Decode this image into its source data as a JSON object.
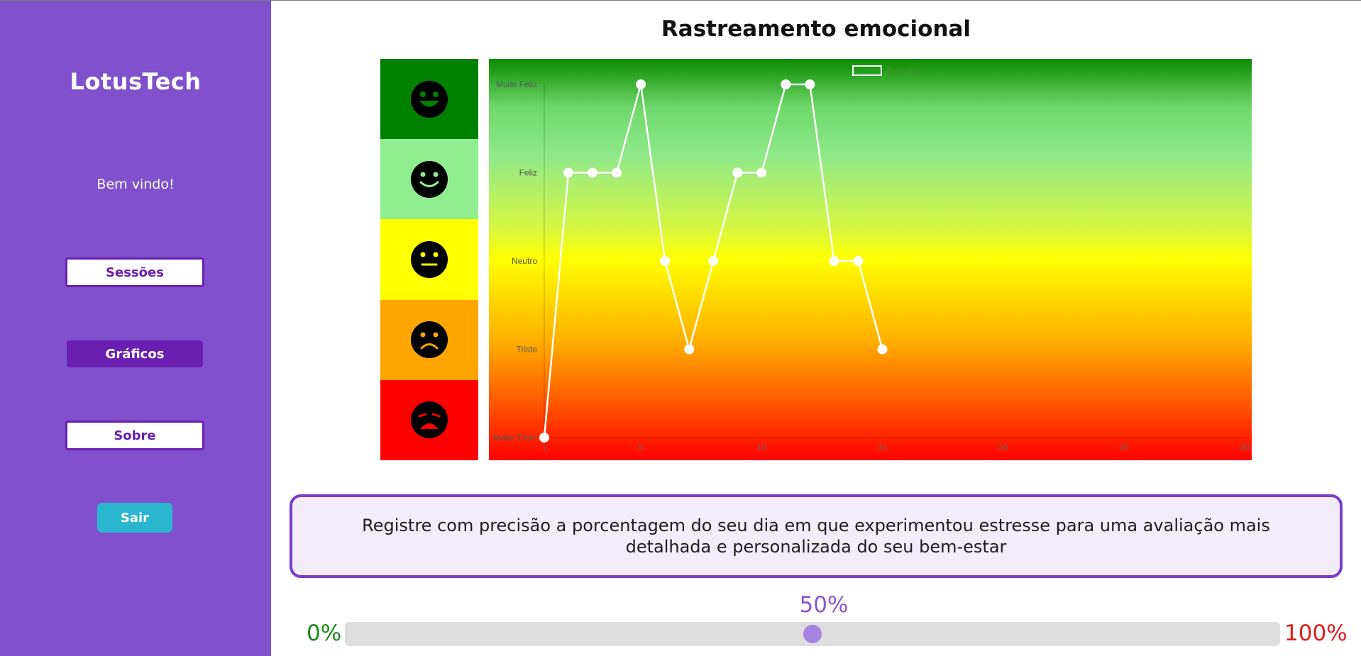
{
  "sidebar": {
    "brand": "LotusTech",
    "welcome": "Bem vindo!",
    "nav": [
      {
        "label": "Sessões"
      },
      {
        "label": "Gráficos"
      },
      {
        "label": "Sobre"
      }
    ],
    "logout": "Sair",
    "color": "#8150cc",
    "active_color": "#6a1fb0"
  },
  "main": {
    "title": "Rastreamento emocional",
    "info_text": "Registre com precisão a porcentagem do seu dia em que experimentou estresse para uma avaliação mais detalhada e personalizada do seu bem-estar"
  },
  "emoji_scale": [
    {
      "icon": "very-happy-face-icon",
      "color": "#008000"
    },
    {
      "icon": "happy-face-icon",
      "color": "#90ee90"
    },
    {
      "icon": "neutral-face-icon",
      "color": "#ffff00"
    },
    {
      "icon": "sad-face-icon",
      "color": "#ffa500"
    },
    {
      "icon": "very-sad-face-icon",
      "color": "#ff0000"
    }
  ],
  "chart_data": {
    "type": "line",
    "title": "",
    "legend": "Emoção",
    "legend_position": "top-center",
    "x_ticks": [
      1,
      5,
      10,
      15,
      20,
      25,
      30
    ],
    "xlim": [
      1,
      30
    ],
    "y_categories": [
      "Muito Triste",
      "Triste",
      "Neutro",
      "Feliz",
      "Muito Feliz"
    ],
    "series": [
      {
        "name": "Emoção",
        "color": "#ffffff",
        "x": [
          1,
          2,
          3,
          4,
          5,
          6,
          7,
          8,
          9,
          10,
          11,
          12,
          13,
          14,
          15
        ],
        "values": [
          0,
          3,
          3,
          3,
          4,
          2,
          1,
          2,
          3,
          3,
          4,
          4,
          2,
          2,
          1
        ]
      }
    ]
  },
  "stress": {
    "value_label": "50%",
    "value": 0.5,
    "min_label": "0%",
    "max_label": "100%"
  }
}
